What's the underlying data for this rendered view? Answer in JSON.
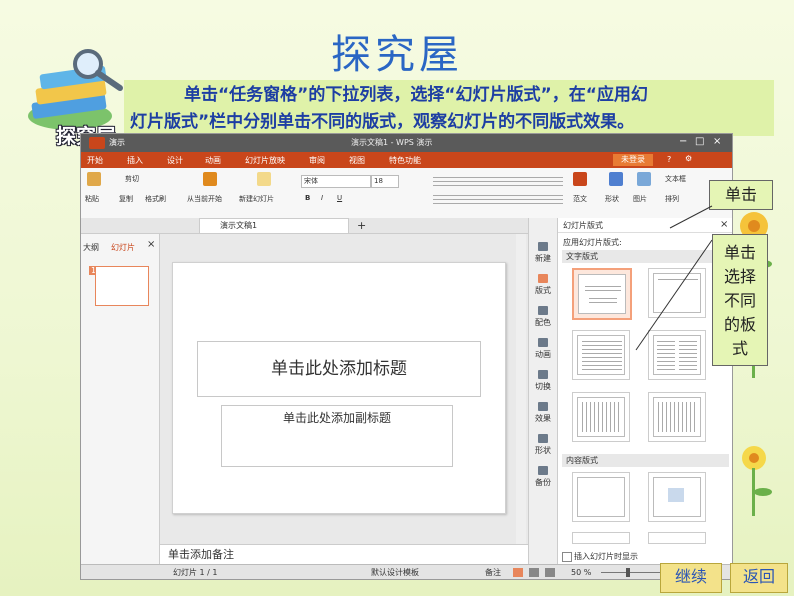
{
  "slide": {
    "title": "探究屋",
    "instruction_line1": "单击“任务窗格”的下拉列表，选择“幻灯片版式”，在“应用幻",
    "instruction_line2": "灯片版式”栏中分别单击不同的版式，观察幻灯片的不同版式效果。",
    "logo_text": "探究屋",
    "callout_click": "单击",
    "callout_select_lines": [
      "单击",
      "选择",
      "不同",
      "的板",
      "式"
    ],
    "continue_button": "继续",
    "back_button": "返回"
  },
  "app": {
    "app_tab": "演示",
    "doc_title": "演示文稿1 - WPS 演示",
    "menu": [
      "开始",
      "插入",
      "设计",
      "动画",
      "幻灯片放映",
      "审阅",
      "视图",
      "特色功能"
    ],
    "unregistered": "未登录",
    "ribbon": {
      "paste": "粘贴",
      "cut": "剪切",
      "copy": "复制",
      "format_painter": "格式刷",
      "from_current": "从当前开始",
      "new_slide": "新建幻灯片",
      "font": "宋体",
      "font_size": "18",
      "fanwen": "范文",
      "shape": "形状",
      "picture": "图片",
      "textbox": "文本框",
      "arrange": "排列"
    },
    "doc_tab": "演示文稿1",
    "left_tabs": [
      "大纲",
      "幻灯片"
    ],
    "thumb_number": "1",
    "title_placeholder": "单击此处添加标题",
    "subtitle_placeholder": "单击此处添加副标题",
    "notes_placeholder": "单击添加备注",
    "sidebar": [
      "新建",
      "版式",
      "配色",
      "动画",
      "切换",
      "效果",
      "形状",
      "备份"
    ],
    "pane": {
      "header": "幻灯片版式",
      "apply_label": "应用幻灯片版式:",
      "text_layouts": "文字版式",
      "content_layouts": "内容版式",
      "show_on_insert": "插入幻灯片时显示"
    },
    "status": {
      "slide_count": "幻灯片 1 / 1",
      "template": "默认设计模板",
      "notes": "备注",
      "zoom": "50 %"
    }
  }
}
